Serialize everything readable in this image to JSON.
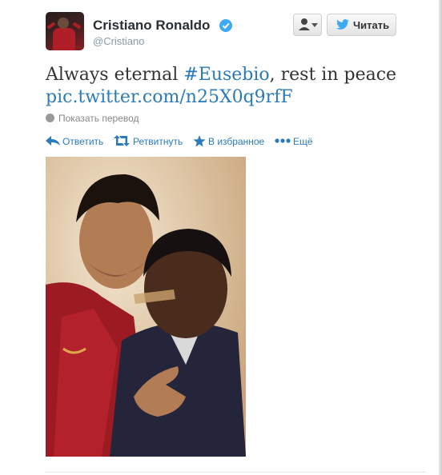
{
  "user": {
    "name": "Cristiano Ronaldo",
    "screen_name": "@Cristiano",
    "verified": true
  },
  "buttons": {
    "follow_label": "Читать"
  },
  "tweet": {
    "text_prefix": "Always eternal ",
    "hashtag": "#Eusebio",
    "text_suffix": ", rest in peace",
    "media_link": "pic.twitter.com/n25X0q9rfF",
    "translate_label": "Показать перевод"
  },
  "actions": {
    "reply": "Ответить",
    "retweet": "Ретвитнуть",
    "favorite": "В избранное",
    "more": "Ещё"
  },
  "colors": {
    "link": "#2b7bb9",
    "verified": "#3ea9f5",
    "shirt": "#b01e28"
  },
  "icons": [
    "person-icon",
    "chevron-down-icon",
    "twitter-bird-icon",
    "verified-icon",
    "globe-icon",
    "reply-icon",
    "retweet-icon",
    "star-icon",
    "more-icon"
  ]
}
